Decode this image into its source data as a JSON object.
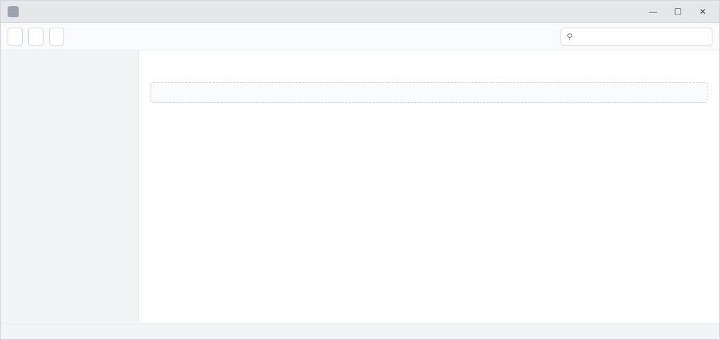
{
  "window": {
    "title": "",
    "minimize_glyph": "—",
    "maximize_glyph": "☐",
    "close_glyph": "✕"
  },
  "toolbar": {
    "buttons": [
      "",
      "",
      ""
    ],
    "search_placeholder": "",
    "search_value": ""
  },
  "sidebar": {
    "items": [
      "",
      "",
      "",
      "",
      ""
    ]
  },
  "main": {
    "title": "",
    "content_note": ""
  },
  "status": {
    "text": ""
  }
}
